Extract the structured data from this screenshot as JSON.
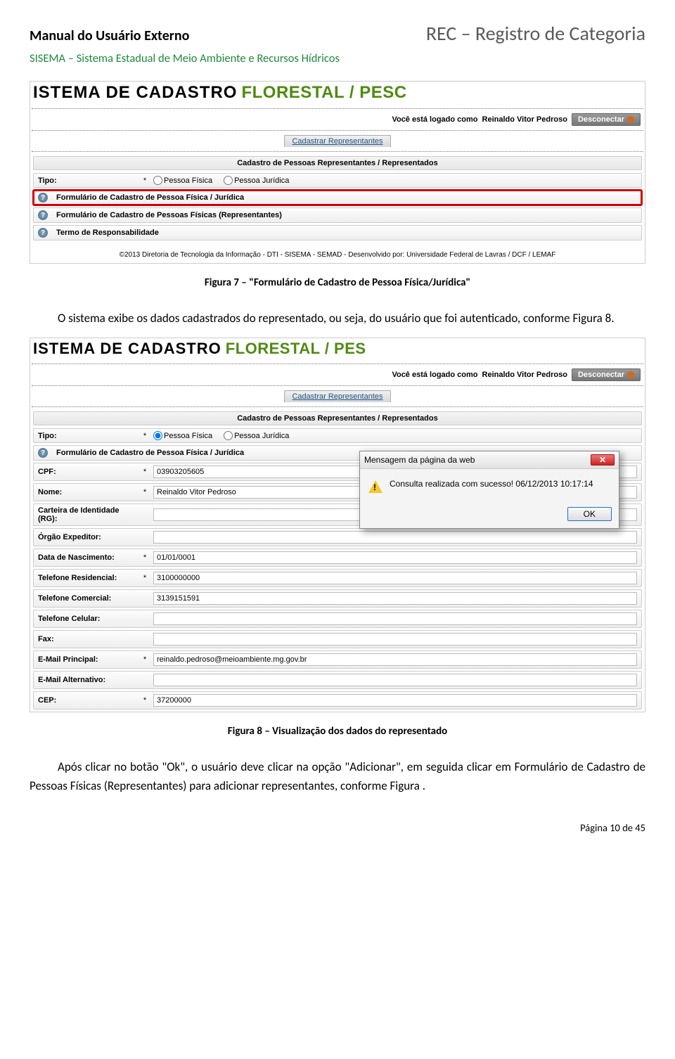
{
  "header": {
    "left": "Manual do Usuário Externo",
    "right": "REC – Registro de Categoria",
    "sub": "SISEMA – Sistema Estadual de Meio Ambiente e Recursos Hídricos"
  },
  "shot1": {
    "sys_black": "ISTEMA   DE   CADASTRO",
    "sys_green": "FLORESTAL / PESC",
    "logged_as_label": "Você está logado como",
    "logged_as_user": "Reinaldo Vitor Pedroso",
    "desconectar": "Desconectar",
    "tab": "Cadastrar Representantes",
    "section": "Cadastro de Pessoas Representantes / Representados",
    "tipo_label": "Tipo:",
    "pf": "Pessoa Física",
    "pj": "Pessoa Jurídica",
    "panel_a": "Formulário de Cadastro de Pessoa Física / Jurídica",
    "panel_b": "Formulário de Cadastro de Pessoas Físicas (Representantes)",
    "panel_c": "Termo de Responsabilidade",
    "copyright": "©2013 Diretoria de Tecnologia da Informação - DTI - SISEMA - SEMAD - Desenvolvido por: Universidade Federal de Lavras / DCF / LEMAF"
  },
  "caption1": "Figura 7 – \"Formulário de Cadastro de Pessoa Física/Jurídica\"",
  "para1": "O sistema exibe os dados cadastrados do representado, ou seja, do usuário que foi autenticado, conforme Figura 8.",
  "shot2": {
    "sys_black": "ISTEMA   DE   CADASTRO",
    "sys_green": "FLORESTAL / PES",
    "logged_as_label": "Você está logado como",
    "logged_as_user": "Reinaldo Vitor Pedroso",
    "desconectar": "Desconectar",
    "tab": "Cadastrar Representantes",
    "section": "Cadastro de Pessoas Representantes / Representados",
    "tipo_label": "Tipo:",
    "pf": "Pessoa Física",
    "pj": "Pessoa Jurídica",
    "panel_a": "Formulário de Cadastro de Pessoa Física / Jurídica",
    "fields": {
      "cpf_l": "CPF:",
      "cpf_v": "03903205605",
      "nome_l": "Nome:",
      "nome_v": "Reinaldo Vitor Pedroso",
      "rg_l": "Carteira de Identidade (RG):",
      "rg_v": "",
      "orgao_l": "Órgão Expeditor:",
      "orgao_v": "",
      "data_l": "Data de Nascimento:",
      "data_v": "01/01/0001",
      "telr_l": "Telefone Residencial:",
      "telr_v": "3100000000",
      "telc_l": "Telefone Comercial:",
      "telc_v": "3139151591",
      "telm_l": "Telefone Celular:",
      "telm_v": "",
      "fax_l": "Fax:",
      "fax_v": "",
      "emailp_l": "E-Mail Principal:",
      "emailp_v": "reinaldo.pedroso@meioambiente.mg.gov.br",
      "emaila_l": "E-Mail Alternativo:",
      "emaila_v": "",
      "cep_l": "CEP:",
      "cep_v": "37200000"
    },
    "dialog": {
      "title": "Mensagem da página da web",
      "msg": "Consulta realizada com sucesso! 06/12/2013 10:17:14",
      "ok": "OK"
    }
  },
  "caption2": "Figura 8 – Visualização dos dados do representado",
  "para2": "Após clicar no botão \"Ok\", o usuário deve clicar na opção \"Adicionar\", em seguida clicar em Formulário de Cadastro de Pessoas Físicas (Representantes) para adicionar representantes, conforme Figura .",
  "footer": "Página 10 de 45"
}
